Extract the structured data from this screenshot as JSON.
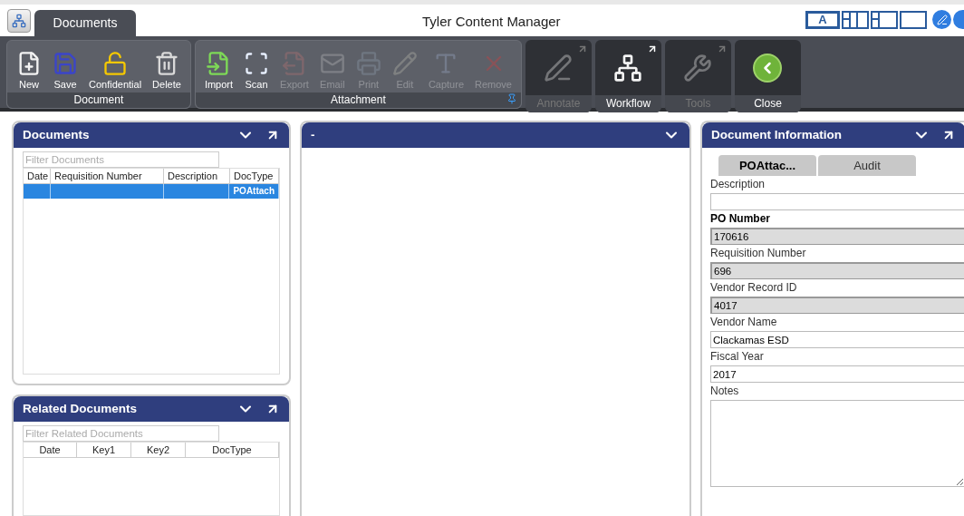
{
  "app_title": "Tyler Content Manager",
  "ribbon_tabs": [
    {
      "label": "Documents",
      "selected": true
    }
  ],
  "view_buttons": [
    {
      "kind": "letter",
      "label": "A",
      "selected": true
    },
    {
      "kind": "three-column",
      "selected": false
    },
    {
      "kind": "split",
      "selected": false
    },
    {
      "kind": "single",
      "selected": false
    }
  ],
  "ribbon_groups": [
    {
      "kind": "group",
      "label": "Document",
      "pin": false,
      "buttons": [
        {
          "kind": "new",
          "label": "New",
          "disabled": false
        },
        {
          "kind": "save",
          "label": "Save",
          "disabled": false
        },
        {
          "kind": "lock",
          "label": "Confidential",
          "disabled": false
        },
        {
          "kind": "delete",
          "label": "Delete",
          "disabled": false
        }
      ]
    },
    {
      "kind": "group",
      "label": "Attachment",
      "pin": true,
      "buttons": [
        {
          "kind": "import",
          "label": "Import",
          "disabled": false
        },
        {
          "kind": "scan",
          "label": "Scan",
          "disabled": false
        },
        {
          "kind": "export",
          "label": "Export",
          "disabled": true
        },
        {
          "kind": "email",
          "label": "Email",
          "disabled": true
        },
        {
          "kind": "print",
          "label": "Print",
          "disabled": true
        },
        {
          "kind": "edit",
          "label": "Edit",
          "disabled": true
        },
        {
          "kind": "capture",
          "label": "Capture",
          "disabled": true
        },
        {
          "kind": "remove",
          "label": "Remove",
          "disabled": true
        }
      ]
    },
    {
      "kind": "annotate",
      "label": "Annotate",
      "disabled": true,
      "expand": true
    },
    {
      "kind": "workflow",
      "label": "Workflow",
      "disabled": false,
      "expand": true
    },
    {
      "kind": "tools",
      "label": "Tools",
      "disabled": true,
      "expand": true
    },
    {
      "kind": "close",
      "label": "Close",
      "disabled": false,
      "expand": false
    }
  ],
  "documents_panel": {
    "title": "Documents",
    "filter_placeholder": "Filter Documents",
    "columns": [
      "Date",
      "Requisition Number",
      "Description",
      "DocType"
    ],
    "rows": [
      {
        "cells": [
          "",
          "",
          "",
          "POAttach"
        ],
        "selected": true
      }
    ]
  },
  "related_panel": {
    "title": "Related Documents",
    "filter_placeholder": "Filter Related Documents",
    "columns": [
      "Date",
      "Key1",
      "Key2",
      "DocType"
    ]
  },
  "viewer_panel": {
    "title": "-"
  },
  "info_panel": {
    "title": "Document Information",
    "tabs": [
      {
        "label": "POAttac...",
        "selected": true
      },
      {
        "label": "Audit",
        "selected": false
      }
    ],
    "fields": [
      {
        "label": "Description",
        "bold": false,
        "kind": "text",
        "readonly": false
      },
      {
        "label": "PO Number",
        "bold": true,
        "kind": "text",
        "readonly": true,
        "value": "170616"
      },
      {
        "label": "Requisition Number",
        "bold": false,
        "kind": "text",
        "readonly": true,
        "value": "696"
      },
      {
        "label": "Vendor Record ID",
        "bold": false,
        "kind": "text",
        "readonly": true,
        "value": "4017"
      },
      {
        "label": "Vendor Name",
        "bold": false,
        "kind": "text",
        "readonly": false,
        "value": "Clackamas ESD"
      },
      {
        "label": "Fiscal Year",
        "bold": false,
        "kind": "text",
        "readonly": false,
        "value": "2017"
      },
      {
        "label": "Notes",
        "bold": false,
        "kind": "textarea",
        "readonly": false
      }
    ]
  }
}
